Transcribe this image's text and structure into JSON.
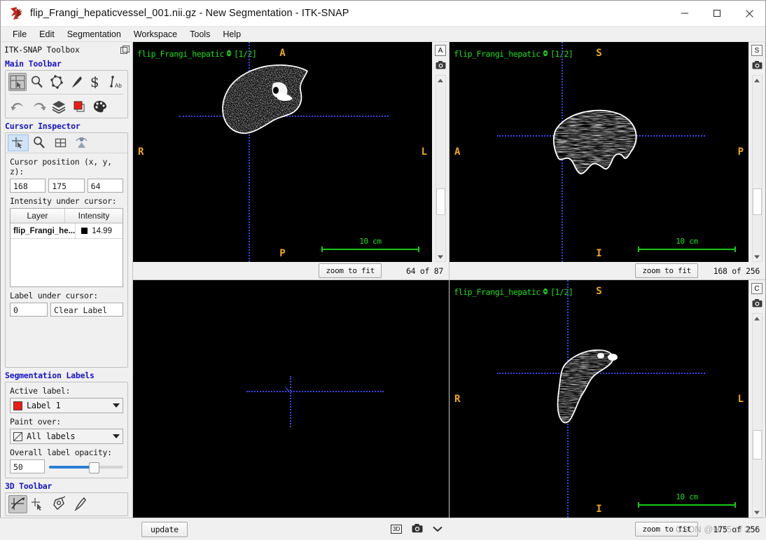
{
  "window": {
    "title": "flip_Frangi_hepaticvessel_001.nii.gz - New Segmentation - ITK-SNAP",
    "app_icon": "itksnap-logo-icon",
    "minimize": "minimize-icon",
    "maximize": "maximize-icon",
    "close": "close-icon"
  },
  "menu": {
    "items": [
      "File",
      "Edit",
      "Segmentation",
      "Workspace",
      "Tools",
      "Help"
    ]
  },
  "toolbox": {
    "title": "ITK-SNAP Toolbox",
    "undock_icon": "undock-icon",
    "main_toolbar": {
      "heading": "Main Toolbar",
      "row1": [
        {
          "name": "crosshair-tool-icon",
          "active": true
        },
        {
          "name": "zoom-pan-tool-icon",
          "active": false
        },
        {
          "name": "polygon-tool-icon",
          "active": false
        },
        {
          "name": "paintbrush-tool-icon",
          "active": false
        },
        {
          "name": "snake-tool-icon",
          "active": false
        },
        {
          "name": "annotation-tool-icon",
          "active": false
        }
      ],
      "row2": [
        {
          "name": "undo-icon",
          "active": false
        },
        {
          "name": "redo-icon",
          "active": false
        },
        {
          "name": "layers-icon",
          "active": false
        },
        {
          "name": "label-color-icon",
          "active": false
        },
        {
          "name": "palette-icon",
          "active": false
        }
      ]
    },
    "cursor_inspector": {
      "heading": "Cursor Inspector",
      "tabs": [
        {
          "name": "crosshair-inspector-icon",
          "active": true
        },
        {
          "name": "zoom-inspector-icon",
          "active": false
        },
        {
          "name": "grid-inspector-icon",
          "active": false
        },
        {
          "name": "registration-inspector-icon",
          "active": false
        }
      ],
      "cursor_position_label": "Cursor position (x, y, z):",
      "cursor_position": [
        "168",
        "175",
        "64"
      ],
      "intensity_label": "Intensity under cursor:",
      "intensity_table": {
        "columns": [
          "Layer",
          "Intensity"
        ],
        "rows": [
          {
            "layer": "flip_Frangi_he...",
            "swatch": "#000000",
            "intensity": "14.99"
          }
        ]
      },
      "label_under_cursor_label": "Label under cursor:",
      "label_under_cursor_id": "0",
      "label_under_cursor_name": "Clear Label"
    },
    "segmentation_labels": {
      "heading": "Segmentation Labels",
      "active_label_caption": "Active label:",
      "active_label_value": "Label 1",
      "active_label_color": "#ed1c16",
      "paint_over_caption": "Paint over:",
      "paint_over_value": "All labels",
      "opacity_caption": "Overall label opacity:",
      "opacity_value": "50"
    },
    "toolbar_3d": {
      "heading": "3D Toolbar",
      "buttons": [
        {
          "name": "crosshair-3d-icon",
          "active": true
        },
        {
          "name": "scalpel-pointer-icon",
          "active": false
        },
        {
          "name": "spray-icon",
          "active": false
        },
        {
          "name": "scalpel-icon",
          "active": false
        }
      ]
    }
  },
  "panels": [
    {
      "id": "axial",
      "overlay_name": "flip_Frangi_hepatic",
      "overlay_eye_icon": "eye-icon",
      "overlay_index": "[1/2]",
      "dir_top": "A",
      "dir_bottom": "P",
      "dir_left": "R",
      "dir_right": "L",
      "ruler_label": "10 cm",
      "orientation_button": "A",
      "camera_icon": "camera-icon",
      "zoom_button": "zoom to fit",
      "slice_status": "64 of 87"
    },
    {
      "id": "sagittal",
      "overlay_name": "flip_Frangi_hepatic",
      "overlay_eye_icon": "eye-icon",
      "overlay_index": "[1/2]",
      "dir_top": "S",
      "dir_bottom": "I",
      "dir_left": "A",
      "dir_right": "P",
      "ruler_label": "10 cm",
      "orientation_button": "S",
      "camera_icon": "camera-icon",
      "zoom_button": "zoom to fit",
      "slice_status": "168 of 256"
    },
    {
      "id": "render3d",
      "overlay_name": "",
      "overlay_index": "",
      "dir_top": "",
      "dir_bottom": "",
      "dir_left": "",
      "dir_right": "",
      "ruler_label": "",
      "orientation_button": "",
      "camera_icon": "",
      "zoom_button": "",
      "slice_status": ""
    },
    {
      "id": "coronal",
      "overlay_name": "flip_Frangi_hepatic",
      "overlay_eye_icon": "eye-icon",
      "overlay_index": "[1/2]",
      "dir_top": "S",
      "dir_bottom": "I",
      "dir_left": "R",
      "dir_right": "L",
      "ruler_label": "10 cm",
      "orientation_button": "C",
      "camera_icon": "camera-icon",
      "zoom_button": "zoom to fit",
      "slice_status": "175 of 256"
    }
  ],
  "bottom_bar": {
    "update_button": "update",
    "icon_3d": "3D",
    "camera_icon": "camera-icon",
    "chevron_icon": "chevron-down-icon"
  },
  "watermark": "CSDN @Hi75 of 256",
  "colors": {
    "crosshair": "#3b46f0",
    "overlay_text": "#18e018",
    "direction_text": "#f0a818",
    "ruler": "#18c818",
    "section_heading": "#1414c8",
    "active_label": "#ed1c16",
    "slider_fill": "#2b7fd4"
  }
}
